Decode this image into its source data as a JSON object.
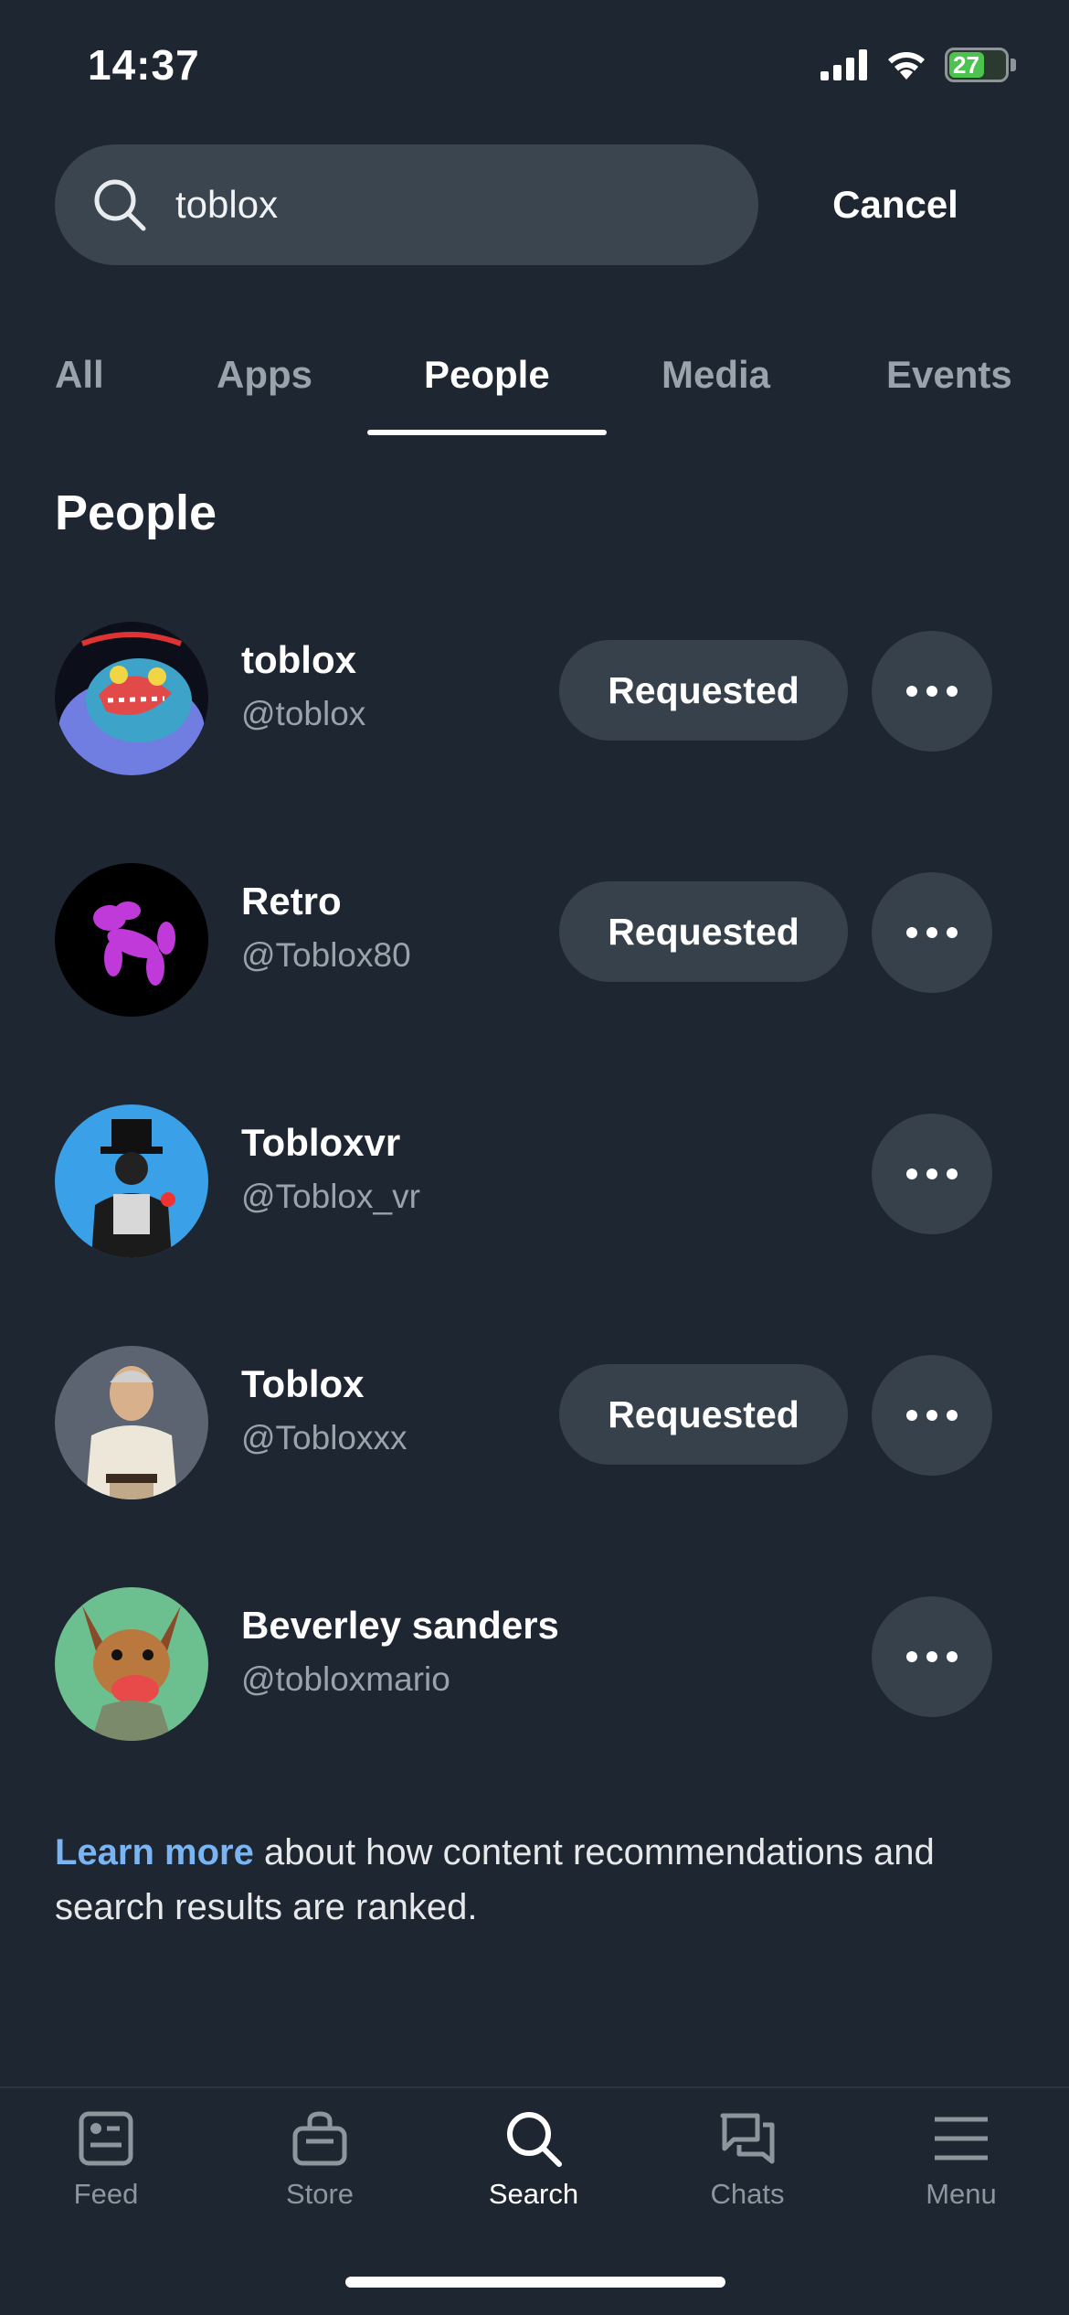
{
  "status_bar": {
    "time": "14:37",
    "battery": "27"
  },
  "search": {
    "value": "toblox",
    "cancel_label": "Cancel"
  },
  "tabs": [
    {
      "label": "All"
    },
    {
      "label": "Apps"
    },
    {
      "label": "People",
      "active": true
    },
    {
      "label": "Media"
    },
    {
      "label": "Events"
    }
  ],
  "section_title": "People",
  "people": [
    {
      "name": "toblox",
      "handle": "@toblox",
      "button": "Requested"
    },
    {
      "name": "Retro",
      "handle": "@Toblox80",
      "button": "Requested"
    },
    {
      "name": "Tobloxvr",
      "handle": "@Toblox_vr",
      "button": ""
    },
    {
      "name": "Toblox",
      "handle": "@Tobloxxx",
      "button": "Requested"
    },
    {
      "name": "Beverley sanders",
      "handle": "@tobloxmario",
      "button": ""
    }
  ],
  "note": {
    "link": "Learn more",
    "text": " about how content recommendations and search results are ranked."
  },
  "nav": [
    {
      "label": "Feed",
      "icon": "feed-icon"
    },
    {
      "label": "Store",
      "icon": "store-icon"
    },
    {
      "label": "Search",
      "icon": "search-icon",
      "active": true
    },
    {
      "label": "Chats",
      "icon": "chats-icon"
    },
    {
      "label": "Menu",
      "icon": "menu-icon"
    }
  ],
  "colors": {
    "background": "#1e2731",
    "button": "#36414b",
    "link": "#7bb4f3",
    "muted": "#9aa3ab"
  }
}
